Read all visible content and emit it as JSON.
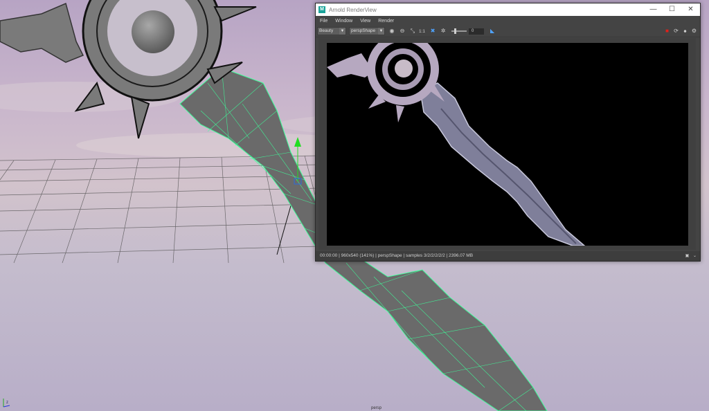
{
  "window": {
    "title": "Arnold RenderView",
    "app_icon": "M",
    "controls": [
      "—",
      "☐",
      "✕"
    ]
  },
  "menu": [
    "File",
    "Window",
    "View",
    "Render"
  ],
  "toolbar": {
    "aov_select": "Beauty",
    "camera_select": "perspShape",
    "ratio_label": "1:1",
    "exposure_value": "0"
  },
  "status": {
    "text": "00:00:00 | 960x540 (141%) | perspShape  | samples 3/2/2/2/2/2 | 2396.07 MB"
  },
  "viewport": {
    "axis_z": "z",
    "camera_label": "persp"
  },
  "colors": {
    "wireframe_accent": "#3dff9a",
    "manipulator": "#22dd22",
    "stop_button": "#e0201a"
  }
}
